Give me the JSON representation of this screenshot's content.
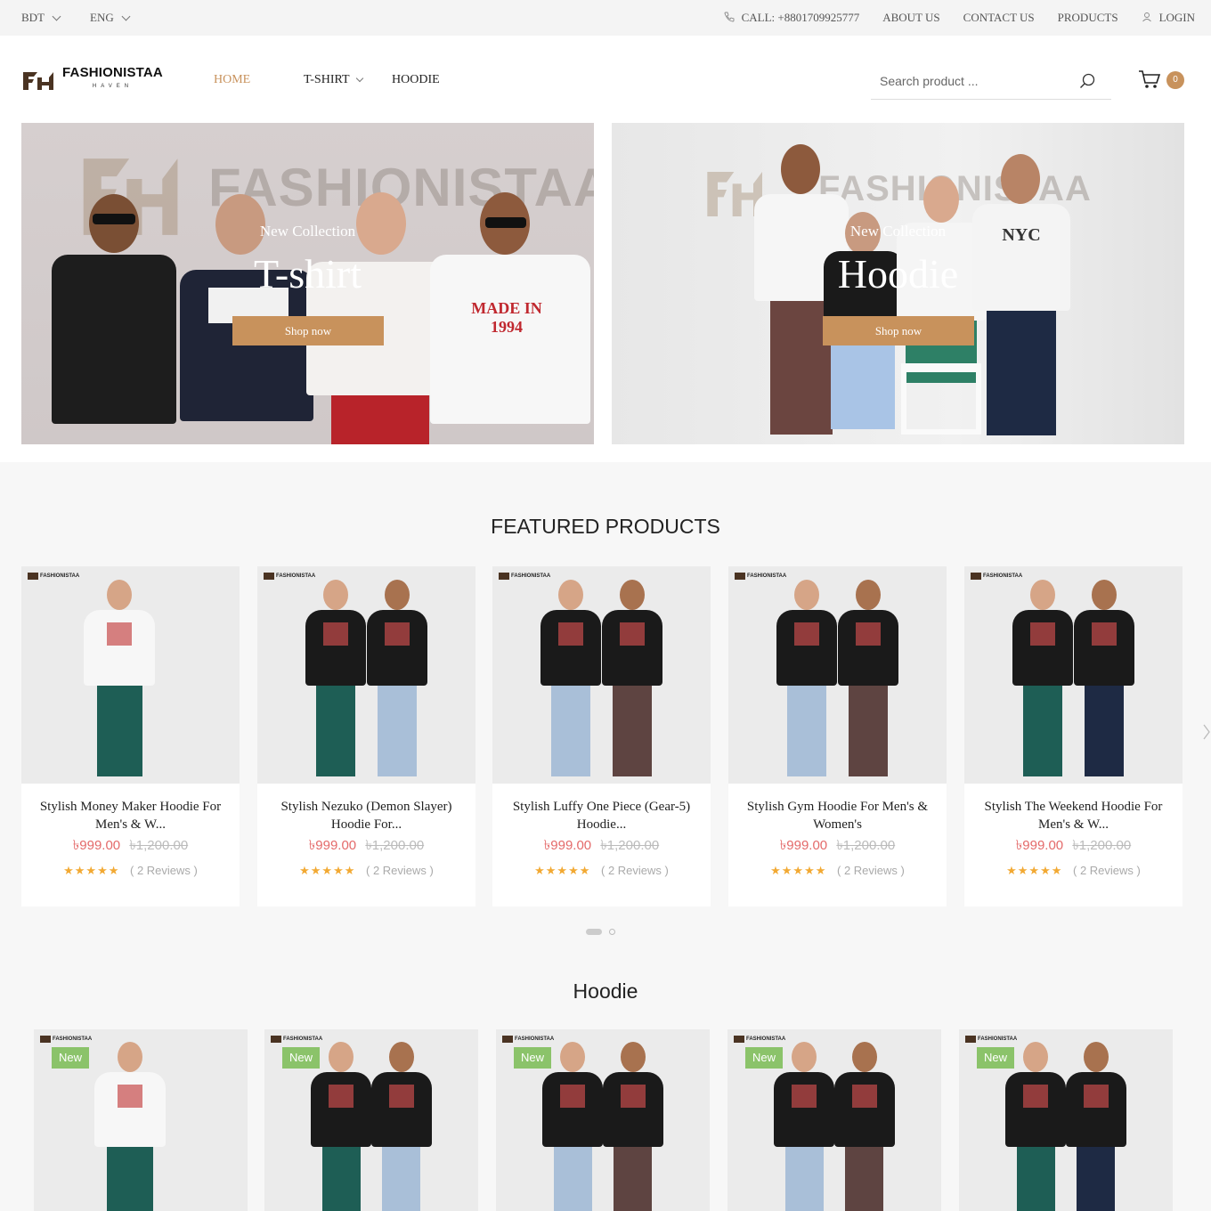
{
  "topbar": {
    "currency": "BDT",
    "language": "ENG",
    "call": "CALL: +8801709925777",
    "about": "ABOUT US",
    "contact": "CONTACT US",
    "products": "PRODUCTS",
    "login": "LOGIN"
  },
  "header": {
    "logo_text": "FASHIONISTAA",
    "logo_sub": "HAVEN",
    "nav": [
      "HOME",
      "T-SHIRT",
      "HOODIE"
    ],
    "search_placeholder": "Search product ...",
    "cart_count": "0"
  },
  "banners": [
    {
      "watermark": "FASHIONISTAA",
      "subtitle": "New Collection",
      "title": "T-shirt",
      "button": "Shop now"
    },
    {
      "watermark": "FASHIONISTAA",
      "subtitle": "New Collection",
      "title": "Hoodie",
      "button": "Shop now"
    }
  ],
  "featured": {
    "title": "FEATURED PRODUCTS",
    "products": [
      {
        "name": "Stylish Money Maker Hoodie For Men's & W...",
        "price": "৳999.00",
        "old_price": "৳1,200.00",
        "stars": "★★★★★",
        "reviews": "( 2 Reviews )"
      },
      {
        "name": "Stylish Nezuko (Demon Slayer) Hoodie For...",
        "price": "৳999.00",
        "old_price": "৳1,200.00",
        "stars": "★★★★★",
        "reviews": "( 2 Reviews )"
      },
      {
        "name": "Stylish Luffy One Piece (Gear-5) Hoodie...",
        "price": "৳999.00",
        "old_price": "৳1,200.00",
        "stars": "★★★★★",
        "reviews": "( 2 Reviews )"
      },
      {
        "name": "Stylish Gym Hoodie For Men's & Women's",
        "price": "৳999.00",
        "old_price": "৳1,200.00",
        "stars": "★★★★★",
        "reviews": "( 2 Reviews )"
      },
      {
        "name": "Stylish The Weekend Hoodie For Men's & W...",
        "price": "৳999.00",
        "old_price": "৳1,200.00",
        "stars": "★★★★★",
        "reviews": "( 2 Reviews )"
      }
    ]
  },
  "hoodie_section": {
    "title": "Hoodie",
    "badge": "New"
  },
  "colors": {
    "accent": "#c8925c",
    "sale_price": "#e46a6a",
    "star": "#f2a933",
    "new_badge": "#8bc36a"
  }
}
